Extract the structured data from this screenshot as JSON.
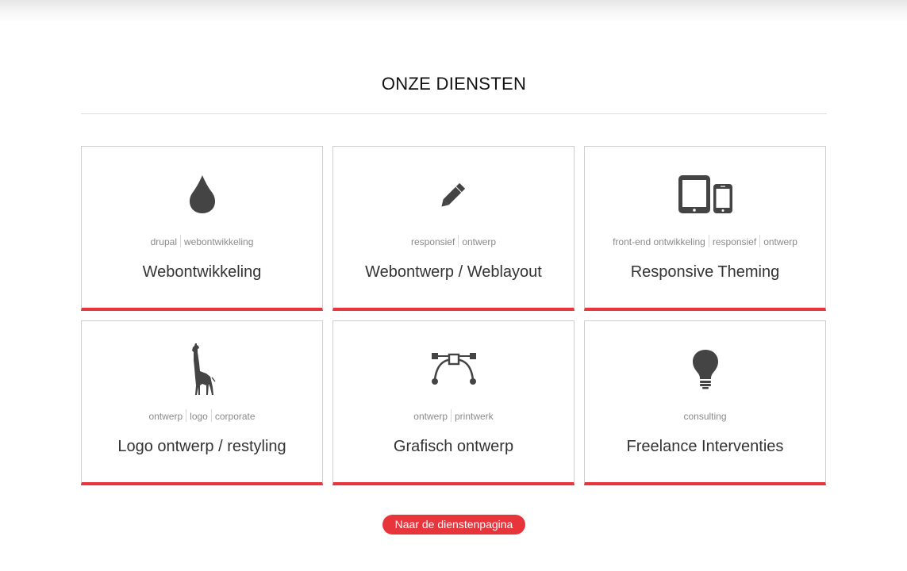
{
  "section": {
    "title": "ONZE DIENSTEN"
  },
  "services": [
    {
      "icon": "drop-icon",
      "tags": [
        "drupal",
        "webontwikkeling"
      ],
      "title": "Webontwikkeling"
    },
    {
      "icon": "pencil-icon",
      "tags": [
        "responsief",
        "ontwerp"
      ],
      "title": "Webontwerp / Weblayout"
    },
    {
      "icon": "devices-icon",
      "tags": [
        "front-end ontwikkeling",
        "responsief",
        "ontwerp"
      ],
      "title": "Responsive Theming"
    },
    {
      "icon": "giraffe-icon",
      "tags": [
        "ontwerp",
        "logo",
        "corporate"
      ],
      "title": "Logo ontwerp / restyling"
    },
    {
      "icon": "bezier-pen-icon",
      "tags": [
        "ontwerp",
        "printwerk"
      ],
      "title": "Grafisch ontwerp"
    },
    {
      "icon": "lightbulb-icon",
      "tags": [
        "consulting"
      ],
      "title": "Freelance Interventies"
    }
  ],
  "cta": {
    "label": "Naar de dienstenpagina"
  },
  "colors": {
    "accent": "#e8353b",
    "icon": "#444444",
    "tag_text": "#8a8a8a",
    "card_border": "#cfcfcf"
  }
}
